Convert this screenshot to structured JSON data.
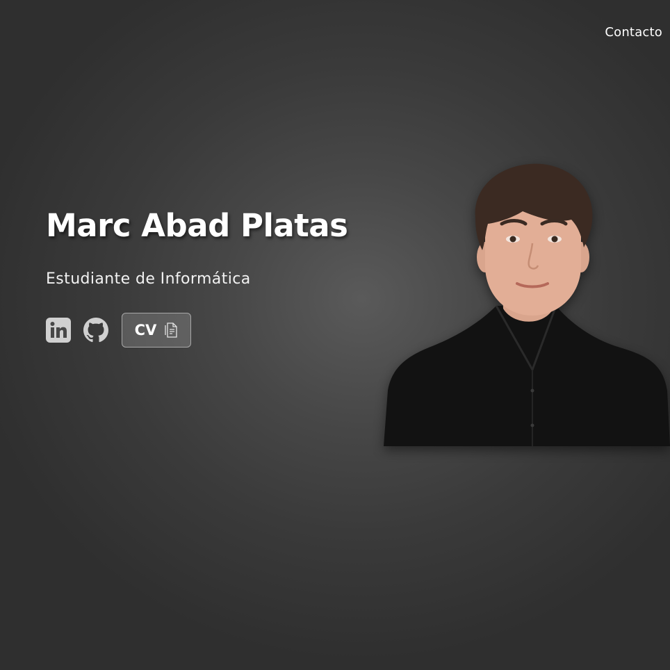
{
  "nav": {
    "contact_label": "Contacto"
  },
  "hero": {
    "name": "Marc Abad Platas",
    "subtitle": "Estudiante de Informática",
    "portrait_alt": "Marc Abad Platas"
  },
  "social": {
    "linkedin_icon": "linkedin-icon",
    "github_icon": "github-icon",
    "cv_label": "CV",
    "cv_icon": "document-icon"
  },
  "colors": {
    "background": "#474747",
    "text": "#ffffff",
    "icon": "#d0d0d0",
    "button_border": "#a8a8a8"
  }
}
